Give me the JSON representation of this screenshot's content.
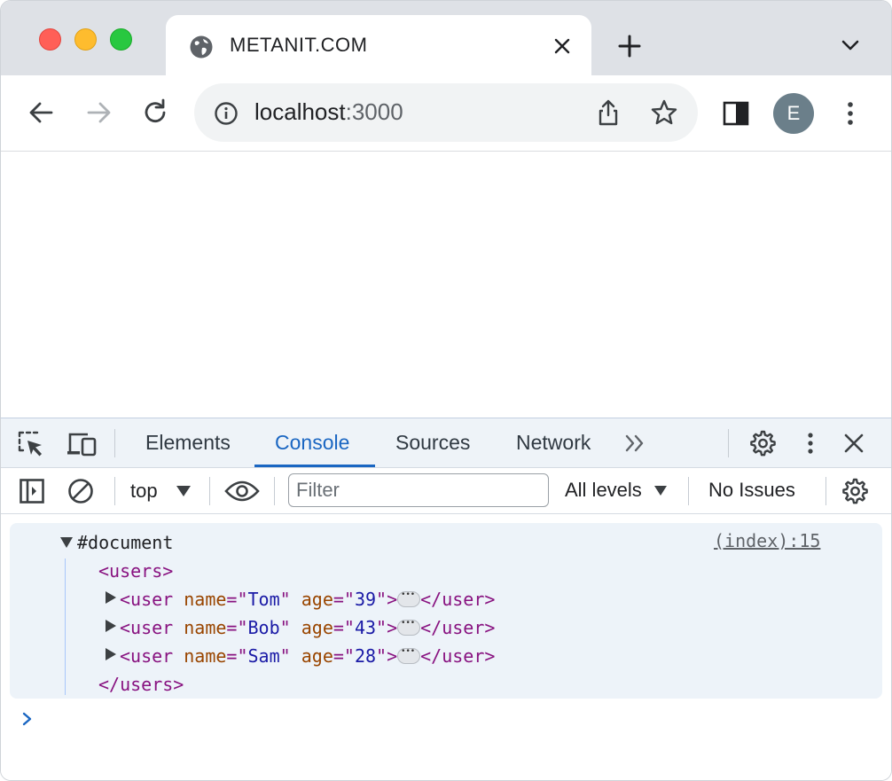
{
  "tab": {
    "title": "METANIT.COM"
  },
  "toolbar": {
    "url_host": "localhost",
    "url_port": ":3000",
    "avatar_letter": "E"
  },
  "devtools": {
    "tabs": [
      "Elements",
      "Console",
      "Sources",
      "Network"
    ],
    "active_tab": "Console",
    "console_bar": {
      "context": "top",
      "filter_placeholder": "Filter",
      "levels": "All levels",
      "issues": "No Issues"
    },
    "message": {
      "root": "#document",
      "source": "(index):15",
      "open_tag": "<users>",
      "close_tag": "</users>",
      "users": [
        {
          "name": "Tom",
          "age": "39"
        },
        {
          "name": "Bob",
          "age": "43"
        },
        {
          "name": "Sam",
          "age": "28"
        }
      ]
    }
  },
  "colors": {
    "accent": "#1a66c2",
    "tag": "#881280",
    "attr": "#994500",
    "value": "#1a1aa6"
  },
  "icons": [
    "globe-icon",
    "close-icon",
    "plus-icon",
    "chevron-down-icon",
    "back-arrow-icon",
    "forward-arrow-icon",
    "reload-icon",
    "info-icon",
    "share-icon",
    "star-icon",
    "side-panel-icon",
    "kebab-menu-icon",
    "inspect-element-icon",
    "device-toolbar-icon",
    "more-tabs-icon",
    "gear-icon",
    "close-devtools-icon",
    "sidebar-toggle-icon",
    "clear-console-icon",
    "eye-icon",
    "console-prompt-icon"
  ]
}
